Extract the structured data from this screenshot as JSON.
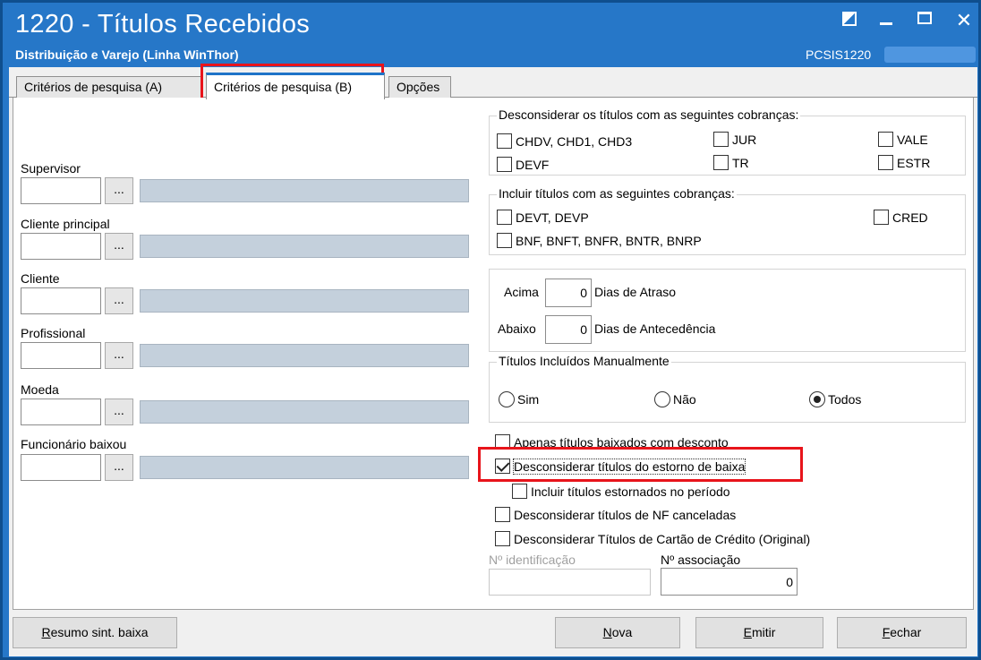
{
  "window": {
    "title": "1220 - Títulos Recebidos",
    "subtitle": "Distribuição e Varejo (Linha WinThor)",
    "program": "PCSIS1220"
  },
  "tabs": [
    {
      "label": "Critérios de pesquisa (A)",
      "active": false
    },
    {
      "label": "Critérios de pesquisa (B)",
      "active": true
    },
    {
      "label": "Opções",
      "active": false
    }
  ],
  "left_fields": {
    "supervisor": {
      "label": "Supervisor",
      "code": "",
      "button": "..."
    },
    "cliente_principal": {
      "label": "Cliente principal",
      "code": "",
      "button": "..."
    },
    "cliente": {
      "label": "Cliente",
      "code": "",
      "button": "..."
    },
    "profissional": {
      "label": "Profissional",
      "code": "",
      "button": "..."
    },
    "moeda": {
      "label": "Moeda",
      "code": "",
      "button": "..."
    },
    "funcionario_baixou": {
      "label": "Funcionário baixou",
      "code": "",
      "button": "..."
    }
  },
  "desconsiderar_cobrancas": {
    "title": "Desconsiderar os títulos com as seguintes cobranças:",
    "items": [
      {
        "label": "CHDV, CHD1, CHD3",
        "checked": false
      },
      {
        "label": "JUR",
        "checked": false
      },
      {
        "label": "VALE",
        "checked": false
      },
      {
        "label": "DEVF",
        "checked": false
      },
      {
        "label": "TR",
        "checked": false
      },
      {
        "label": "ESTR",
        "checked": false
      }
    ]
  },
  "incluir_cobrancas": {
    "title": "Incluir títulos com as seguintes cobranças:",
    "items": [
      {
        "label": "DEVT, DEVP",
        "checked": false
      },
      {
        "label": "CRED",
        "checked": false
      },
      {
        "label": "BNF, BNFT, BNFR, BNTR, BNRP",
        "checked": false
      }
    ]
  },
  "dias": {
    "acima_label": "Acima",
    "acima_value": "0",
    "acima_suffix": "Dias de Atraso",
    "abaixo_label": "Abaixo",
    "abaixo_value": "0",
    "abaixo_suffix": "Dias de Antecedência"
  },
  "manual": {
    "title": "Títulos Incluídos Manualmente",
    "options": [
      {
        "label": "Sim",
        "checked": false
      },
      {
        "label": "Não",
        "checked": false
      },
      {
        "label": "Todos",
        "checked": true
      }
    ]
  },
  "options": {
    "apenas_desconto": {
      "label": "Apenas títulos baixados com desconto",
      "checked": false
    },
    "desconsiderar_estorno": {
      "label": "Desconsiderar títulos do estorno de baixa",
      "checked": true
    },
    "incluir_estornados": {
      "label": "Incluir títulos estornados no período",
      "checked": false
    },
    "desconsiderar_nf": {
      "label": "Desconsiderar títulos de NF canceladas",
      "checked": false
    },
    "desconsiderar_cartao": {
      "label": "Desconsiderar Títulos de Cartão de Crédito (Original)",
      "checked": false
    }
  },
  "identificacao": {
    "label": "Nº identificação",
    "value": ""
  },
  "associacao": {
    "label": "Nº associação",
    "value": "0"
  },
  "buttons": {
    "resumo_pre": "R",
    "resumo_post": "esumo sint. baixa",
    "nova_pre": "N",
    "nova_post": "ova",
    "emitir_pre": "E",
    "emitir_post": "mitir",
    "fechar_pre": "F",
    "fechar_post": "echar"
  }
}
